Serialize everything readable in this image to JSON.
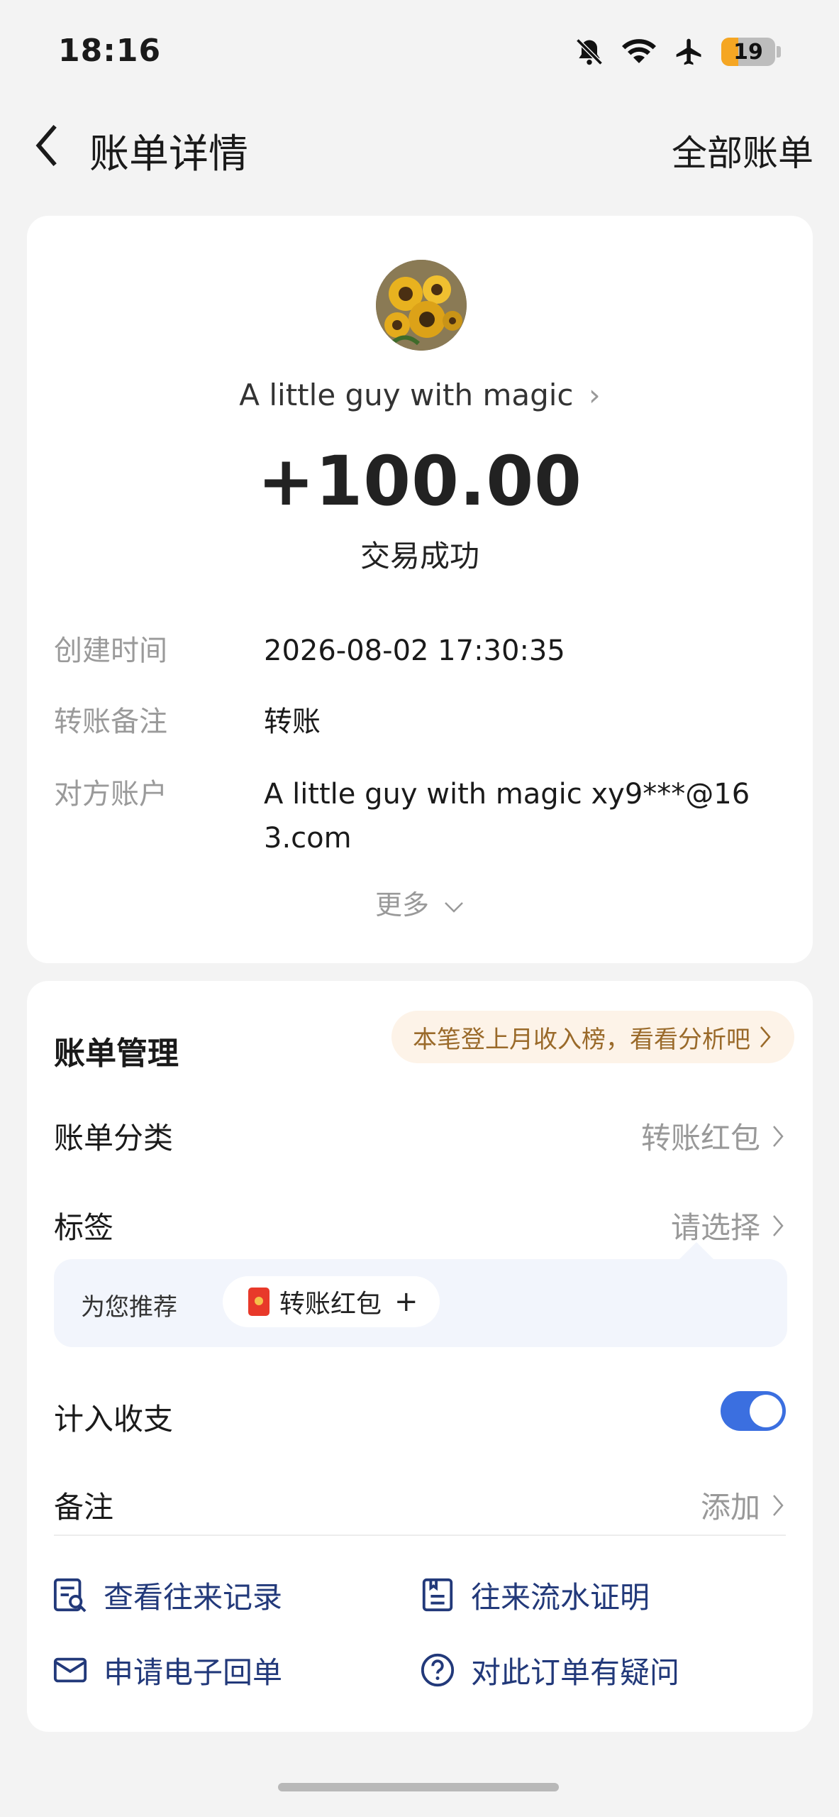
{
  "status_bar": {
    "time": "18:16",
    "battery": "19",
    "icons": [
      "bell-off-icon",
      "wifi-icon",
      "airplane-icon",
      "battery-icon"
    ]
  },
  "nav": {
    "title": "账单详情",
    "right_link": "全部账单"
  },
  "transaction": {
    "payee": "A little guy with magic",
    "amount": "+100.00",
    "status": "交易成功",
    "details": [
      {
        "label": "创建时间",
        "value": "2026-08-02 17:30:35"
      },
      {
        "label": "转账备注",
        "value": "转账"
      },
      {
        "label": "对方账户",
        "value": "A little guy with magic xy9***@163.com"
      }
    ],
    "more_label": "更多"
  },
  "management": {
    "title": "账单管理",
    "promo": "本笔登上月收入榜，看看分析吧",
    "category": {
      "label": "账单分类",
      "value": "转账红包"
    },
    "tag": {
      "label": "标签",
      "value": "请选择"
    },
    "recommend": {
      "label": "为您推荐",
      "chip": "转账红包"
    },
    "include_in_stats": {
      "label": "计入收支",
      "enabled": true
    },
    "note": {
      "label": "备注",
      "value": "添加"
    },
    "actions": [
      {
        "label": "查看往来记录",
        "icon": "records-search-icon"
      },
      {
        "label": "往来流水证明",
        "icon": "statement-icon"
      },
      {
        "label": "申请电子回单",
        "icon": "mail-icon"
      },
      {
        "label": "对此订单有疑问",
        "icon": "question-icon"
      }
    ]
  },
  "colors": {
    "accent": "#3b6fe0",
    "action_text": "#22397a",
    "promo_bg": "#fdf3e8",
    "promo_text": "#9a6a2a",
    "muted": "#999999"
  }
}
